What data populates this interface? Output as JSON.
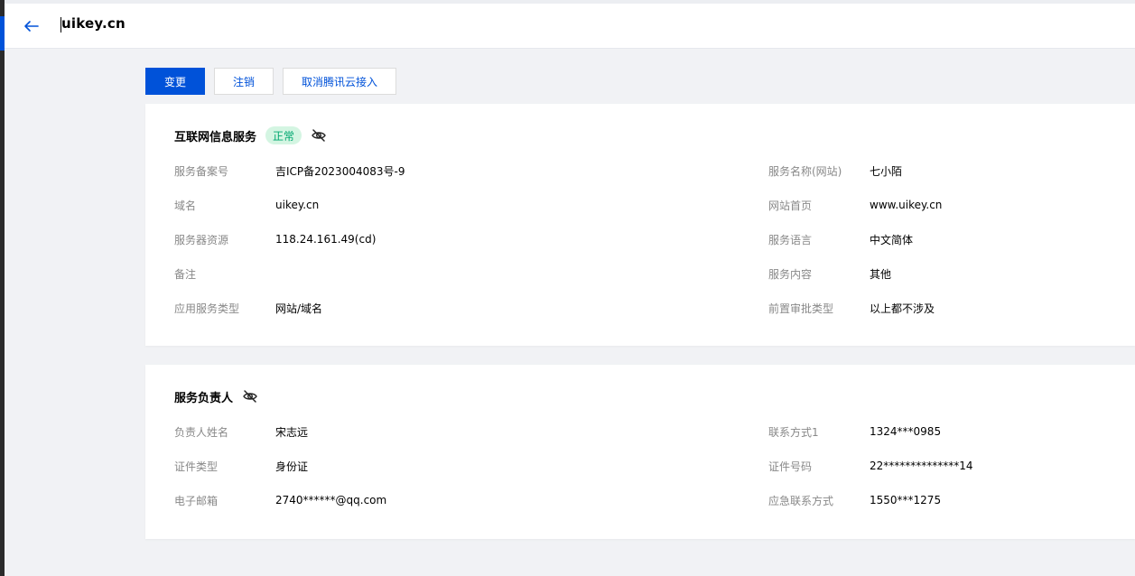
{
  "header": {
    "title": "uikey.cn",
    "back_icon": "arrow-left-icon"
  },
  "actions": {
    "change_label": "变更",
    "cancel_label": "注销",
    "unlink_label": "取消腾讯云接入"
  },
  "colors": {
    "primary": "#0052d9",
    "badge_bg": "#d4f5e2",
    "badge_text": "#00a870"
  },
  "service_card": {
    "title": "互联网信息服务",
    "status": "正常",
    "eye_icon": "eye-off-icon",
    "left_fields": [
      {
        "label": "服务备案号",
        "value": "吉ICP备2023004083号-9"
      },
      {
        "label": "域名",
        "value": "uikey.cn"
      },
      {
        "label": "服务器资源",
        "value": "118.24.161.49(cd)"
      },
      {
        "label": "备注",
        "value": ""
      },
      {
        "label": "应用服务类型",
        "value": "网站/域名"
      }
    ],
    "right_fields": [
      {
        "label": "服务名称(网站)",
        "value": "七小陌"
      },
      {
        "label": "网站首页",
        "value": "www.uikey.cn"
      },
      {
        "label": "服务语言",
        "value": "中文简体"
      },
      {
        "label": "服务内容",
        "value": "其他"
      },
      {
        "label": "前置审批类型",
        "value": "以上都不涉及"
      }
    ]
  },
  "owner_card": {
    "title": "服务负责人",
    "eye_icon": "eye-off-icon",
    "left_fields": [
      {
        "label": "负责人姓名",
        "value": "宋志远"
      },
      {
        "label": "证件类型",
        "value": "身份证"
      },
      {
        "label": "电子邮箱",
        "value": "2740******@qq.com"
      }
    ],
    "right_fields": [
      {
        "label": "联系方式1",
        "value": "1324***0985"
      },
      {
        "label": "证件号码",
        "value": "22**************14"
      },
      {
        "label": "应急联系方式",
        "value": "1550***1275"
      }
    ]
  }
}
